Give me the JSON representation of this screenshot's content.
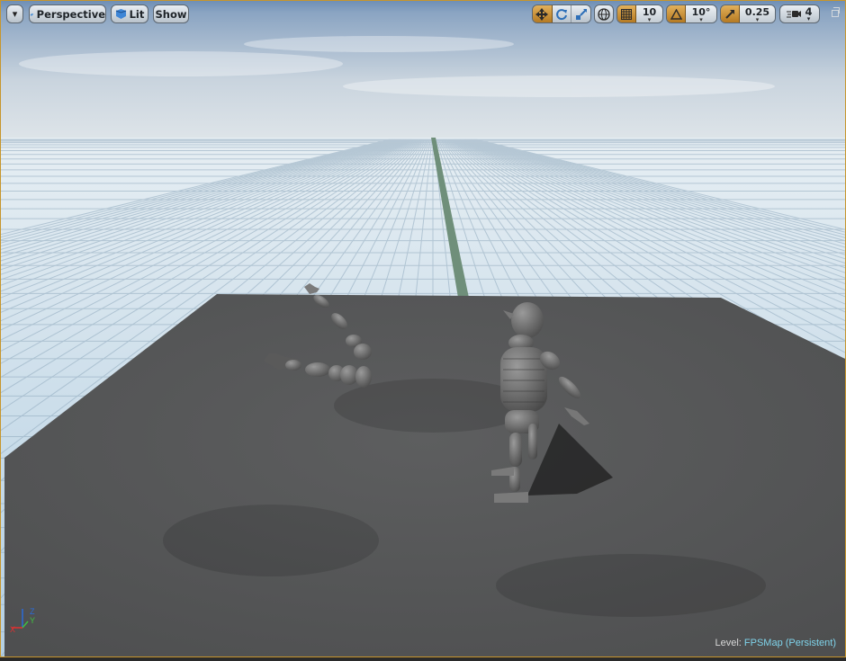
{
  "toolbar": {
    "dropdown_glyph": "▾",
    "perspective_label": "Perspective",
    "lit_label": "Lit",
    "show_label": "Show",
    "grid_snap_value": "10",
    "rotation_snap_value": "10°",
    "scale_snap_value": "0.25",
    "camera_speed_value": "4"
  },
  "status": {
    "level_prefix": "Level:",
    "level_name": "FPSMap (Persistent)"
  },
  "axis_gizmo": {
    "z_label": "Z",
    "y_label": "Y",
    "x_label": "X"
  },
  "colors": {
    "accent": "#c7962d",
    "active_toolbar": "#d9a042",
    "level_name": "#7fd3ea",
    "grid_floor": "#c7dbe8",
    "platform": "#555657",
    "mannequin": "#6e6e6e"
  },
  "icons": [
    "chevron-down-icon",
    "perspective-cube-icon",
    "lit-sphere-icon",
    "translate-icon",
    "rotate-icon",
    "scale-icon",
    "globe-icon",
    "grid-snap-icon",
    "rotation-snap-icon",
    "scale-snap-icon",
    "camera-speed-icon",
    "restore-icon"
  ]
}
